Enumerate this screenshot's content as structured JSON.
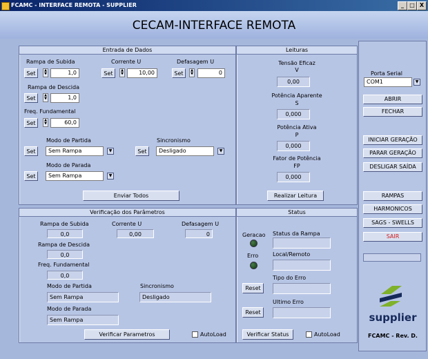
{
  "window": {
    "title": "FCAMC - INTERFACE REMOTA - SUPPLIER",
    "header": "CECAM-INTERFACE REMOTA",
    "min": "_",
    "max": "□",
    "close": "X"
  },
  "entrada": {
    "title": "Entrada de Dados",
    "set_label": "Set",
    "rampa_subida_label": "Rampa de Subida",
    "rampa_subida_value": "1,0",
    "corrente_label": "Corrente U",
    "corrente_value": "10,00",
    "defasagem_label": "Defasagem U",
    "defasagem_value": "0",
    "rampa_descida_label": "Rampa de Descida",
    "rampa_descida_value": "1,0",
    "freq_label": "Freq. Fundamental",
    "freq_value": "60,0",
    "modo_partida_label": "Modo de Partida",
    "modo_partida_value": "Sem Rampa",
    "sincronismo_label": "Sincronismo",
    "sincronismo_value": "Desligado",
    "modo_parada_label": "Modo de Parada",
    "modo_parada_value": "Sem Rampa",
    "enviar_label": "Enviar Todos"
  },
  "leituras": {
    "title": "Leituras",
    "tensao_label": "Tensão Eficaz",
    "tensao_unit": "V",
    "tensao_value": "0,00",
    "potencia_ap_label": "Potência Aparente",
    "potencia_ap_unit": "S",
    "potencia_ap_value": "0,000",
    "potencia_at_label": "Potência Ativa",
    "potencia_at_unit": "P",
    "potencia_at_value": "0,000",
    "fator_label": "Fator de Potência",
    "fator_unit": "FP",
    "fator_value": "0,000",
    "realizar_label": "Realizar Leitura"
  },
  "verificacao": {
    "title": "Verificação dos Parâmetros",
    "rampa_subida_label": "Rampa de Subida",
    "rampa_subida_value": "0,0",
    "corrente_label": "Corrente U",
    "corrente_value": "0,00",
    "defasagem_label": "Defasagem U",
    "defasagem_value": "0",
    "rampa_descida_label": "Rampa de Descida",
    "rampa_descida_value": "0,0",
    "freq_label": "Freq. Fundamental",
    "freq_value": "0,0",
    "modo_partida_label": "Modo de Partida",
    "modo_partida_value": "Sem Rampa",
    "sincronismo_label": "Sincronismo",
    "sincronismo_value": "Desligado",
    "modo_parada_label": "Modo de Parada",
    "modo_parada_value": "Sem Rampa",
    "verificar_label": "Verificar Parametros",
    "autoload_label": "AutoLoad"
  },
  "status": {
    "title": "Status",
    "geracao_label": "Geracao",
    "erro_label": "Erro",
    "status_rampa_label": "Status da Rampa",
    "local_remoto_label": "Local/Remoto",
    "tipo_erro_label": "Tipo do Erro",
    "ultimo_erro_label": "Ultimo Erro",
    "reset_label": "Reset",
    "verificar_label": "Verificar Status",
    "autoload_label": "AutoLoad"
  },
  "sidebar": {
    "porta_label": "Porta Serial",
    "porta_value": "COM1",
    "abrir": "ABRIR",
    "fechar": "FECHAR",
    "iniciar": "INICIAR GERAÇÃO",
    "parar": "PARAR GERAÇÃO",
    "desligar": "DESLIGAR SAÍDA",
    "rampas": "RAMPAS",
    "harmonicos": "HARMONICOS",
    "sags": "SAGS - SWELLS",
    "sair": "SAIR",
    "logo_text": "supplier",
    "footer": "FCAMC - Rev. D."
  },
  "colors": {
    "sair": "#d21a1a",
    "logo_green": "#7fb12a",
    "logo_navy": "#162a5a"
  },
  "icons": {
    "arrow": "▼",
    "spin_up": "▲",
    "spin_down": "▼"
  }
}
